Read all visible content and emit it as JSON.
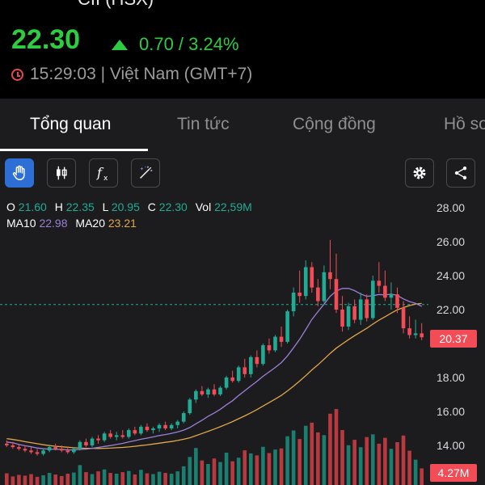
{
  "header": {
    "ticker": "CII (HSX)",
    "price": "22.30",
    "change": "0.70 / 3.24%",
    "time": "15:29:03 | Việt Nam (GMT+7)"
  },
  "tabs": [
    {
      "label": "Tổng quan"
    },
    {
      "label": "Tin tức"
    },
    {
      "label": "Cộng đồng"
    },
    {
      "label": "Hồ sơ"
    }
  ],
  "toolbar": {
    "icons": [
      "hand-icon",
      "candlestick-icon",
      "function-icon",
      "magic-icon",
      "gear-icon",
      "share-icon"
    ]
  },
  "legend": {
    "o_label": "O",
    "o": "21.60",
    "h_label": "H",
    "h": "22.35",
    "l_label": "L",
    "l": "20.95",
    "c_label": "C",
    "c": "22.30",
    "vol_label": "Vol",
    "vol": "22,59M",
    "ma10_label": "MA10",
    "ma10": "22.98",
    "ma20_label": "MA20",
    "ma20": "23.21"
  },
  "colors": {
    "up": "#22ab94",
    "down": "#f24c56",
    "ma10": "#9b7fd6",
    "ma20": "#e0a84a",
    "accent": "#2e6fd6"
  },
  "price_tag": "20.37",
  "volume_tag": "4.27M",
  "y_axis_labels": [
    "28.00",
    "26.00",
    "24.00",
    "22.00",
    "18.00",
    "16.00",
    "14.00"
  ],
  "chart_data": {
    "type": "candlestick",
    "ylim": [
      12,
      29
    ],
    "ohlc": [
      [
        14.1,
        14.3,
        13.9,
        14.0
      ],
      [
        14.0,
        14.2,
        13.8,
        13.9
      ],
      [
        13.9,
        14.1,
        13.7,
        13.8
      ],
      [
        13.8,
        14.0,
        13.6,
        13.7
      ],
      [
        13.7,
        13.9,
        13.5,
        13.6
      ],
      [
        13.6,
        13.8,
        13.4,
        13.5
      ],
      [
        13.5,
        13.8,
        13.4,
        13.7
      ],
      [
        13.7,
        14.0,
        13.6,
        13.9
      ],
      [
        13.9,
        14.1,
        13.7,
        13.8
      ],
      [
        13.8,
        14.0,
        13.6,
        13.7
      ],
      [
        13.7,
        13.9,
        13.5,
        13.6
      ],
      [
        13.6,
        13.9,
        13.5,
        13.8
      ],
      [
        13.8,
        14.3,
        13.7,
        14.2
      ],
      [
        14.2,
        14.4,
        13.9,
        14.0
      ],
      [
        14.0,
        14.5,
        13.9,
        14.4
      ],
      [
        14.4,
        14.6,
        14.1,
        14.3
      ],
      [
        14.3,
        14.8,
        14.2,
        14.7
      ],
      [
        14.7,
        14.9,
        14.4,
        14.5
      ],
      [
        14.5,
        14.8,
        14.3,
        14.6
      ],
      [
        14.6,
        14.9,
        14.4,
        14.5
      ],
      [
        14.5,
        15.0,
        14.4,
        14.9
      ],
      [
        14.9,
        15.1,
        14.6,
        14.7
      ],
      [
        14.7,
        15.2,
        14.6,
        15.1
      ],
      [
        15.1,
        15.3,
        14.8,
        14.9
      ],
      [
        14.9,
        15.1,
        14.7,
        15.0
      ],
      [
        15.0,
        15.3,
        14.8,
        15.2
      ],
      [
        15.2,
        15.4,
        14.9,
        15.0
      ],
      [
        15.0,
        15.3,
        14.9,
        15.2
      ],
      [
        15.2,
        15.5,
        15.0,
        15.4
      ],
      [
        15.4,
        16.0,
        15.3,
        15.9
      ],
      [
        15.9,
        16.8,
        15.8,
        16.7
      ],
      [
        16.7,
        17.3,
        16.5,
        17.2
      ],
      [
        17.2,
        17.5,
        16.9,
        17.0
      ],
      [
        17.0,
        17.4,
        16.8,
        17.3
      ],
      [
        17.3,
        17.6,
        16.9,
        17.0
      ],
      [
        17.0,
        17.5,
        16.9,
        17.4
      ],
      [
        17.4,
        18.1,
        17.3,
        18.0
      ],
      [
        18.0,
        18.4,
        17.7,
        17.8
      ],
      [
        17.8,
        18.7,
        17.7,
        18.6
      ],
      [
        18.6,
        19.1,
        18.0,
        18.2
      ],
      [
        18.2,
        19.3,
        18.0,
        19.2
      ],
      [
        19.2,
        19.6,
        18.6,
        18.8
      ],
      [
        18.8,
        20.0,
        18.7,
        19.9
      ],
      [
        19.9,
        20.3,
        19.4,
        19.6
      ],
      [
        19.6,
        20.5,
        19.5,
        20.4
      ],
      [
        20.4,
        21.0,
        19.8,
        20.1
      ],
      [
        20.1,
        22.0,
        20.0,
        21.9
      ],
      [
        21.9,
        23.3,
        21.6,
        23.0
      ],
      [
        23.0,
        24.3,
        22.4,
        22.8
      ],
      [
        22.8,
        24.9,
        22.6,
        24.5
      ],
      [
        24.5,
        24.8,
        23.0,
        23.3
      ],
      [
        23.3,
        23.8,
        22.2,
        22.5
      ],
      [
        22.5,
        24.6,
        22.4,
        24.2
      ],
      [
        24.2,
        26.1,
        23.2,
        23.8
      ],
      [
        23.8,
        25.3,
        21.8,
        22.0
      ],
      [
        22.0,
        22.8,
        20.7,
        21.0
      ],
      [
        21.0,
        22.4,
        20.8,
        22.2
      ],
      [
        22.2,
        22.6,
        21.2,
        21.4
      ],
      [
        21.4,
        23.0,
        21.1,
        22.6
      ],
      [
        22.6,
        22.9,
        21.3,
        21.5
      ],
      [
        21.5,
        24.0,
        21.4,
        23.7
      ],
      [
        23.7,
        24.8,
        23.0,
        23.4
      ],
      [
        23.4,
        24.3,
        22.5,
        22.7
      ],
      [
        22.7,
        23.6,
        22.0,
        22.9
      ],
      [
        22.9,
        23.3,
        21.8,
        22.1
      ],
      [
        22.1,
        22.5,
        20.6,
        20.9
      ],
      [
        20.9,
        21.6,
        20.3,
        20.5
      ],
      [
        20.5,
        21.4,
        20.3,
        20.6
      ],
      [
        20.6,
        21.2,
        20.2,
        20.37
      ]
    ],
    "volume_m": [
      3.0,
      2.2,
      2.6,
      2.4,
      2.8,
      2.1,
      2.5,
      3.1,
      2.7,
      2.3,
      2.9,
      3.2,
      5.1,
      3.3,
      2.8,
      3.5,
      4.0,
      3.1,
      2.9,
      3.3,
      3.6,
      2.7,
      3.9,
      3.0,
      2.8,
      3.4,
      3.1,
      2.9,
      3.5,
      4.8,
      7.2,
      9.5,
      6.3,
      5.4,
      6.8,
      5.9,
      8.3,
      6.1,
      7.0,
      8.9,
      8.1,
      7.6,
      9.8,
      8.2,
      9.1,
      9.4,
      12.5,
      14.0,
      11.8,
      15.2,
      16.0,
      13.5,
      12.8,
      18.3,
      19.5,
      14.1,
      10.2,
      11.6,
      9.7,
      12.3,
      13.0,
      10.6,
      12.1,
      9.3,
      11.0,
      12.7,
      8.8,
      6.5,
      4.27
    ],
    "ma10": [
      14.2,
      14.15,
      14.05,
      13.98,
      13.92,
      13.85,
      13.8,
      13.78,
      13.77,
      13.76,
      13.74,
      13.73,
      13.76,
      13.78,
      13.83,
      13.88,
      13.94,
      13.99,
      14.05,
      14.12,
      14.2,
      14.28,
      14.36,
      14.43,
      14.5,
      14.58,
      14.64,
      14.71,
      14.79,
      14.9,
      15.05,
      15.27,
      15.48,
      15.71,
      15.91,
      16.13,
      16.39,
      16.63,
      16.94,
      17.22,
      17.5,
      17.77,
      18.07,
      18.33,
      18.59,
      18.88,
      19.27,
      19.75,
      20.25,
      20.83,
      21.42,
      21.88,
      22.32,
      22.78,
      23.1,
      23.25,
      23.25,
      23.12,
      22.92,
      22.78,
      22.82,
      22.89,
      22.86,
      22.91,
      22.84,
      22.63,
      22.47,
      22.37,
      22.19
    ],
    "ma20": [
      14.4,
      14.35,
      14.29,
      14.22,
      14.16,
      14.1,
      14.04,
      13.99,
      13.95,
      13.92,
      13.89,
      13.86,
      13.84,
      13.83,
      13.83,
      13.82,
      13.83,
      13.84,
      13.86,
      13.88,
      13.91,
      13.95,
      13.99,
      14.03,
      14.08,
      14.13,
      14.18,
      14.23,
      14.29,
      14.36,
      14.45,
      14.57,
      14.7,
      14.83,
      14.96,
      15.1,
      15.25,
      15.4,
      15.57,
      15.74,
      15.92,
      16.11,
      16.32,
      16.52,
      16.73,
      16.95,
      17.21,
      17.49,
      17.79,
      18.11,
      18.45,
      18.75,
      19.08,
      19.42,
      19.73,
      19.98,
      20.23,
      20.46,
      20.68,
      20.9,
      21.15,
      21.38,
      21.58,
      21.79,
      21.99,
      22.12,
      22.24,
      22.33,
      22.36
    ],
    "current_price_line": 22.3
  }
}
